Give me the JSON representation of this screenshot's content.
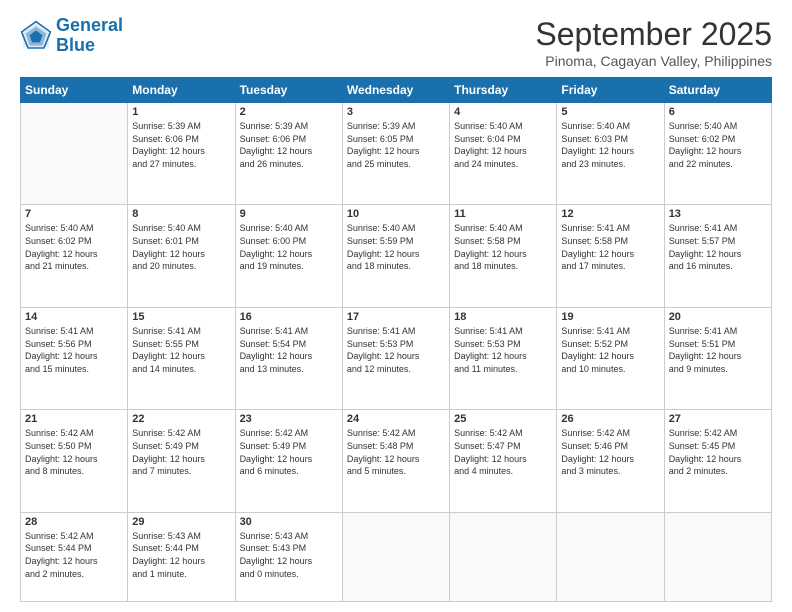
{
  "logo": {
    "line1": "General",
    "line2": "Blue"
  },
  "title": "September 2025",
  "location": "Pinoma, Cagayan Valley, Philippines",
  "headers": [
    "Sunday",
    "Monday",
    "Tuesday",
    "Wednesday",
    "Thursday",
    "Friday",
    "Saturday"
  ],
  "weeks": [
    [
      {
        "day": "",
        "info": ""
      },
      {
        "day": "1",
        "info": "Sunrise: 5:39 AM\nSunset: 6:06 PM\nDaylight: 12 hours\nand 27 minutes."
      },
      {
        "day": "2",
        "info": "Sunrise: 5:39 AM\nSunset: 6:06 PM\nDaylight: 12 hours\nand 26 minutes."
      },
      {
        "day": "3",
        "info": "Sunrise: 5:39 AM\nSunset: 6:05 PM\nDaylight: 12 hours\nand 25 minutes."
      },
      {
        "day": "4",
        "info": "Sunrise: 5:40 AM\nSunset: 6:04 PM\nDaylight: 12 hours\nand 24 minutes."
      },
      {
        "day": "5",
        "info": "Sunrise: 5:40 AM\nSunset: 6:03 PM\nDaylight: 12 hours\nand 23 minutes."
      },
      {
        "day": "6",
        "info": "Sunrise: 5:40 AM\nSunset: 6:02 PM\nDaylight: 12 hours\nand 22 minutes."
      }
    ],
    [
      {
        "day": "7",
        "info": "Sunrise: 5:40 AM\nSunset: 6:02 PM\nDaylight: 12 hours\nand 21 minutes."
      },
      {
        "day": "8",
        "info": "Sunrise: 5:40 AM\nSunset: 6:01 PM\nDaylight: 12 hours\nand 20 minutes."
      },
      {
        "day": "9",
        "info": "Sunrise: 5:40 AM\nSunset: 6:00 PM\nDaylight: 12 hours\nand 19 minutes."
      },
      {
        "day": "10",
        "info": "Sunrise: 5:40 AM\nSunset: 5:59 PM\nDaylight: 12 hours\nand 18 minutes."
      },
      {
        "day": "11",
        "info": "Sunrise: 5:40 AM\nSunset: 5:58 PM\nDaylight: 12 hours\nand 18 minutes."
      },
      {
        "day": "12",
        "info": "Sunrise: 5:41 AM\nSunset: 5:58 PM\nDaylight: 12 hours\nand 17 minutes."
      },
      {
        "day": "13",
        "info": "Sunrise: 5:41 AM\nSunset: 5:57 PM\nDaylight: 12 hours\nand 16 minutes."
      }
    ],
    [
      {
        "day": "14",
        "info": "Sunrise: 5:41 AM\nSunset: 5:56 PM\nDaylight: 12 hours\nand 15 minutes."
      },
      {
        "day": "15",
        "info": "Sunrise: 5:41 AM\nSunset: 5:55 PM\nDaylight: 12 hours\nand 14 minutes."
      },
      {
        "day": "16",
        "info": "Sunrise: 5:41 AM\nSunset: 5:54 PM\nDaylight: 12 hours\nand 13 minutes."
      },
      {
        "day": "17",
        "info": "Sunrise: 5:41 AM\nSunset: 5:53 PM\nDaylight: 12 hours\nand 12 minutes."
      },
      {
        "day": "18",
        "info": "Sunrise: 5:41 AM\nSunset: 5:53 PM\nDaylight: 12 hours\nand 11 minutes."
      },
      {
        "day": "19",
        "info": "Sunrise: 5:41 AM\nSunset: 5:52 PM\nDaylight: 12 hours\nand 10 minutes."
      },
      {
        "day": "20",
        "info": "Sunrise: 5:41 AM\nSunset: 5:51 PM\nDaylight: 12 hours\nand 9 minutes."
      }
    ],
    [
      {
        "day": "21",
        "info": "Sunrise: 5:42 AM\nSunset: 5:50 PM\nDaylight: 12 hours\nand 8 minutes."
      },
      {
        "day": "22",
        "info": "Sunrise: 5:42 AM\nSunset: 5:49 PM\nDaylight: 12 hours\nand 7 minutes."
      },
      {
        "day": "23",
        "info": "Sunrise: 5:42 AM\nSunset: 5:49 PM\nDaylight: 12 hours\nand 6 minutes."
      },
      {
        "day": "24",
        "info": "Sunrise: 5:42 AM\nSunset: 5:48 PM\nDaylight: 12 hours\nand 5 minutes."
      },
      {
        "day": "25",
        "info": "Sunrise: 5:42 AM\nSunset: 5:47 PM\nDaylight: 12 hours\nand 4 minutes."
      },
      {
        "day": "26",
        "info": "Sunrise: 5:42 AM\nSunset: 5:46 PM\nDaylight: 12 hours\nand 3 minutes."
      },
      {
        "day": "27",
        "info": "Sunrise: 5:42 AM\nSunset: 5:45 PM\nDaylight: 12 hours\nand 2 minutes."
      }
    ],
    [
      {
        "day": "28",
        "info": "Sunrise: 5:42 AM\nSunset: 5:44 PM\nDaylight: 12 hours\nand 2 minutes."
      },
      {
        "day": "29",
        "info": "Sunrise: 5:43 AM\nSunset: 5:44 PM\nDaylight: 12 hours\nand 1 minute."
      },
      {
        "day": "30",
        "info": "Sunrise: 5:43 AM\nSunset: 5:43 PM\nDaylight: 12 hours\nand 0 minutes."
      },
      {
        "day": "",
        "info": ""
      },
      {
        "day": "",
        "info": ""
      },
      {
        "day": "",
        "info": ""
      },
      {
        "day": "",
        "info": ""
      }
    ]
  ]
}
